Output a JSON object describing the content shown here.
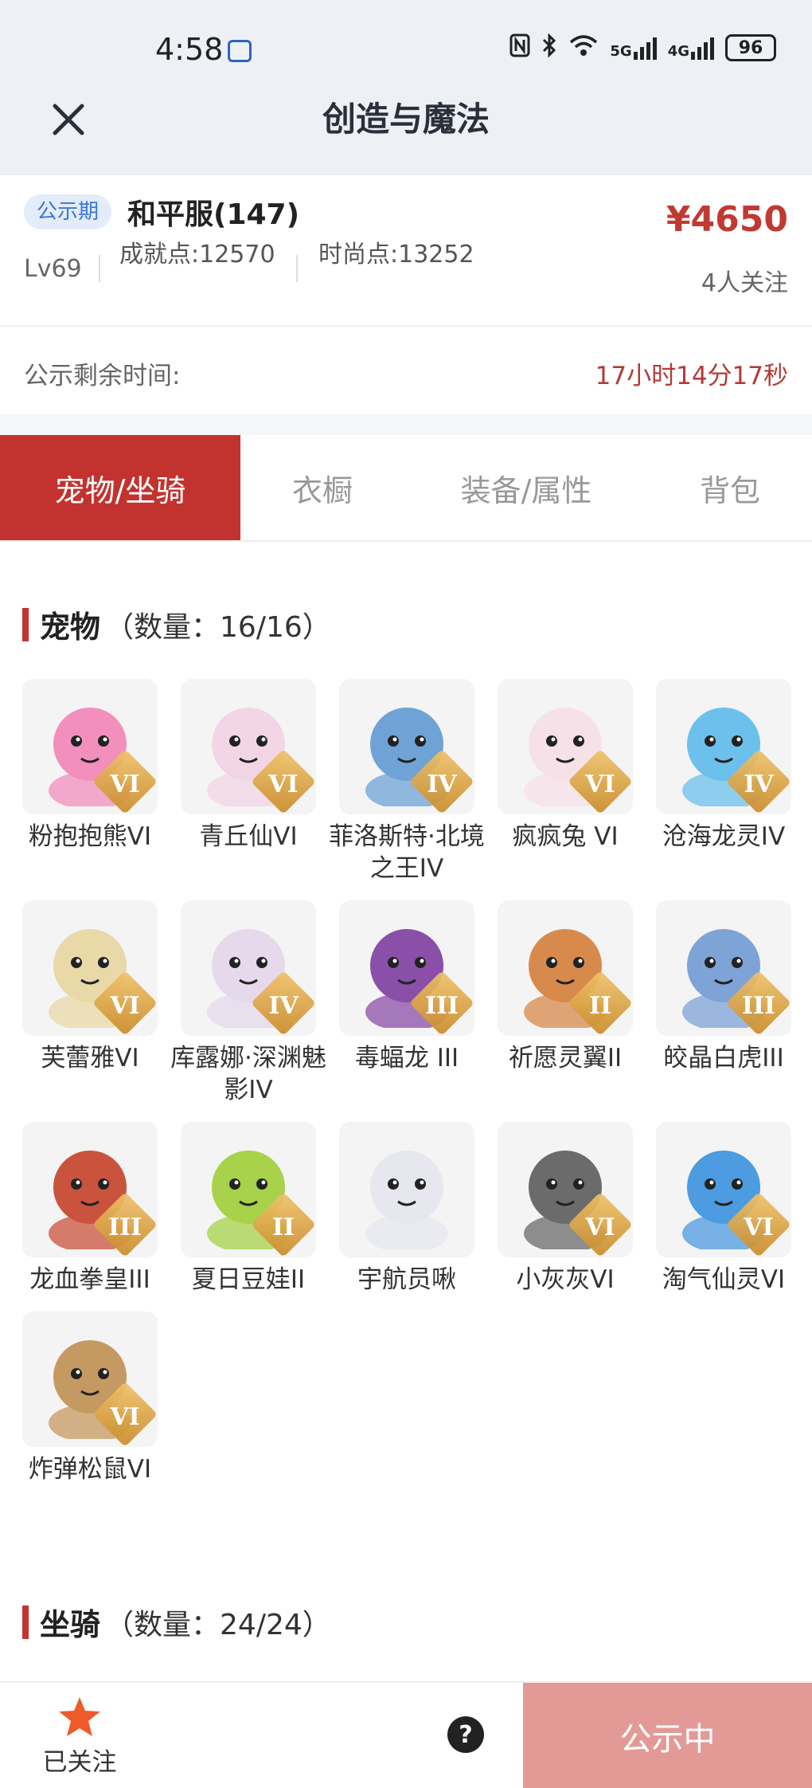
{
  "status_bar": {
    "time": "4:58",
    "network_labels": [
      "5G",
      "4G"
    ],
    "battery": "96"
  },
  "header": {
    "title": "创造与魔法"
  },
  "account": {
    "badge": "公示期",
    "server": "和平服(147)",
    "price": "¥4650",
    "level": "Lv69",
    "achievement": "成就点:12570",
    "fashion": "时尚点:13252",
    "followers": "4人关注",
    "remaining_label": "公示剩余时间:",
    "remaining_value": "17小时14分17秒"
  },
  "tabs": [
    {
      "label": "宠物/坐骑",
      "active": true
    },
    {
      "label": "衣橱",
      "active": false
    },
    {
      "label": "装备/属性",
      "active": false
    },
    {
      "label": "背包",
      "active": false
    }
  ],
  "pets_section": {
    "title": "宠物",
    "count": "（数量：16/16）"
  },
  "pets": [
    {
      "name": "粉抱抱熊VI",
      "tier": "VI",
      "color": "#f28fbd"
    },
    {
      "name": "青丘仙VI",
      "tier": "VI",
      "color": "#f3d6e6"
    },
    {
      "name": "菲洛斯特·北境之王IV",
      "tier": "IV",
      "color": "#6fa3d6"
    },
    {
      "name": "疯疯兔 VI",
      "tier": "VI",
      "color": "#f7e1e8"
    },
    {
      "name": "沧海龙灵IV",
      "tier": "IV",
      "color": "#6cc0ec"
    },
    {
      "name": "芙蕾雅VI",
      "tier": "VI",
      "color": "#e9d9a8"
    },
    {
      "name": "库露娜·深渊魅影IV",
      "tier": "IV",
      "color": "#e6d9ec"
    },
    {
      "name": "毒蝠龙 III",
      "tier": "III",
      "color": "#8a4fa8"
    },
    {
      "name": "祈愿灵翼II",
      "tier": "II",
      "color": "#d88a4c"
    },
    {
      "name": "皎晶白虎III",
      "tier": "III",
      "color": "#7ea3d6"
    },
    {
      "name": "龙血拳皇III",
      "tier": "III",
      "color": "#c9533d"
    },
    {
      "name": "夏日豆娃II",
      "tier": "II",
      "color": "#a7d24a"
    },
    {
      "name": "宇航员啾",
      "tier": "",
      "color": "#e7e7f0"
    },
    {
      "name": "小灰灰VI",
      "tier": "VI",
      "color": "#6b6b6b"
    },
    {
      "name": "淘气仙灵VI",
      "tier": "VI",
      "color": "#4d9be0"
    },
    {
      "name": "炸弹松鼠VI",
      "tier": "VI",
      "color": "#c59a62"
    }
  ],
  "mounts_section": {
    "title": "坐骑",
    "count": "（数量：24/24）"
  },
  "bottom_bar": {
    "follow_label": "已关注",
    "help": "?",
    "status_label": "公示中"
  }
}
